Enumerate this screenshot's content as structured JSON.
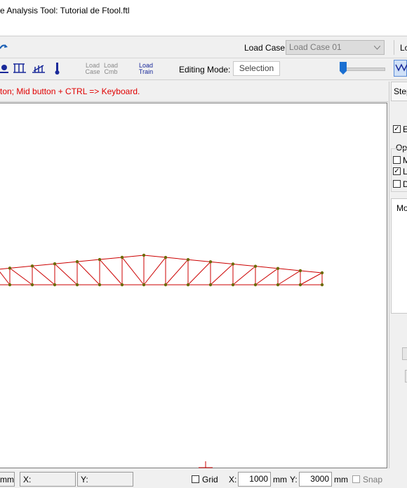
{
  "window": {
    "title": "e Analysis Tool: Tutorial de Ftool.ftl"
  },
  "toolbar1": {
    "load_case_label": "Load Case:",
    "load_case_value": "Load Case 01",
    "cut_label": "Lo"
  },
  "toolbar2": {
    "load_case_btn": [
      "Load",
      "Case"
    ],
    "load_cmb_btn": [
      "Load",
      "Cmb"
    ],
    "load_train_btn": [
      "Load",
      "Train"
    ],
    "editing_mode_label": "Editing Mode:",
    "editing_mode_value": "Selection",
    "slider_level": 0.02
  },
  "message": "ton; Mid button + CTRL => Keyboard.",
  "right_panel": {
    "step_label": "Step",
    "check_e": "E",
    "options_label": "Op",
    "opt1": "M",
    "opt2": "L",
    "opt3": "D",
    "mode_label": "Mo"
  },
  "status": {
    "unit_left": "mm",
    "x_label": "X:",
    "y_label": "Y:",
    "grid_label": "Grid",
    "gx_label": "X:",
    "gx_value": "1000",
    "gx_unit": "mm",
    "gy_label": "Y:",
    "gy_value": "3000",
    "gy_unit": "mm",
    "snap_label": "Snap"
  },
  "colors": {
    "member": "#cc0000",
    "node": "#6b6b00",
    "message": "#e00000",
    "accent": "#1a5fb4"
  }
}
